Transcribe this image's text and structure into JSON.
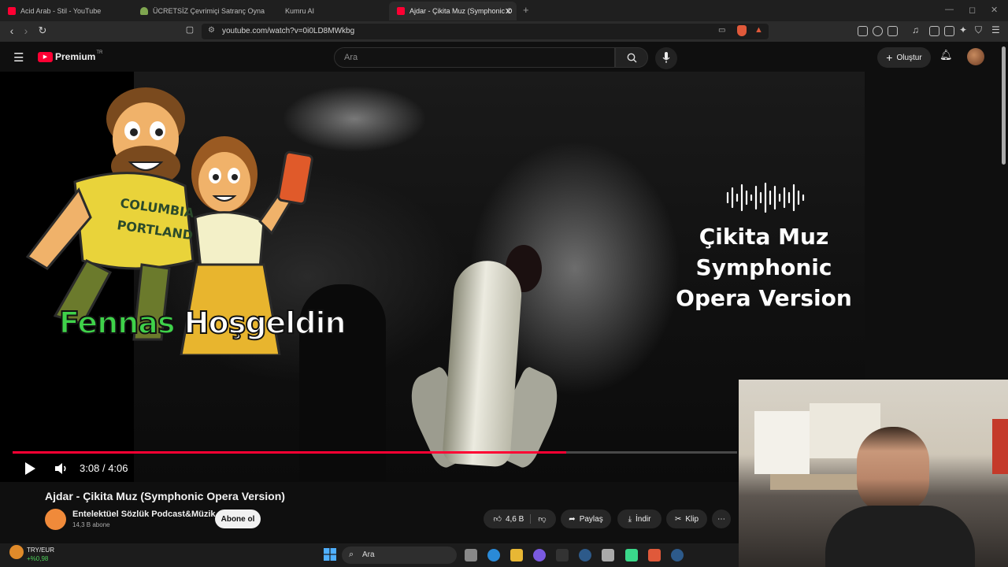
{
  "browser": {
    "tabs": [
      {
        "title": "Acid Arab - Stil - YouTube",
        "favicon_color": "#ff0033"
      },
      {
        "title": "ÜCRETSİZ Çevrimiçi Satranç Oynayın",
        "favicon_color": "#7fa650"
      },
      {
        "title": "Kumru AI",
        "favicon_color": "#1f1f1f"
      },
      {
        "title": "Ajdar - Çikita Muz (Symphonic O",
        "favicon_color": "#ff0033"
      }
    ],
    "new_tab": "+",
    "url": "youtube.com/watch?v=0i0LD8MWkbg"
  },
  "youtube": {
    "logo_text": "Premium",
    "logo_sup": "TR",
    "search_placeholder": "Ara",
    "create_label": "Oluştur",
    "accent": "#ff0033"
  },
  "video": {
    "overlay_title_lines": [
      "Çikita Muz",
      "Symphonic",
      "Opera Version"
    ],
    "cartoon_shirt_lines": [
      "COLUMBIA",
      "PORTLAND"
    ],
    "welcome_name": "Fennas",
    "welcome_word": "Hoşgeldin",
    "time_current": "3:08",
    "time_separator": "/",
    "time_total": "4:06",
    "progress": 0.764
  },
  "below": {
    "title": "Ajdar - Çikita Muz (Symphonic Opera Version)",
    "channel": "Entelektüel Sözlük Podcast&Müzik",
    "subscribers": "14,3 B abone",
    "subscribe_label": "Abone ol",
    "likes": "4,6 B",
    "share_label": "Paylaş",
    "download_label": "İndir",
    "clip_label": "Klip"
  },
  "taskbar": {
    "widget_label": "TRY/EUR",
    "widget_value": "+%0,98",
    "search_label": "Ara"
  }
}
